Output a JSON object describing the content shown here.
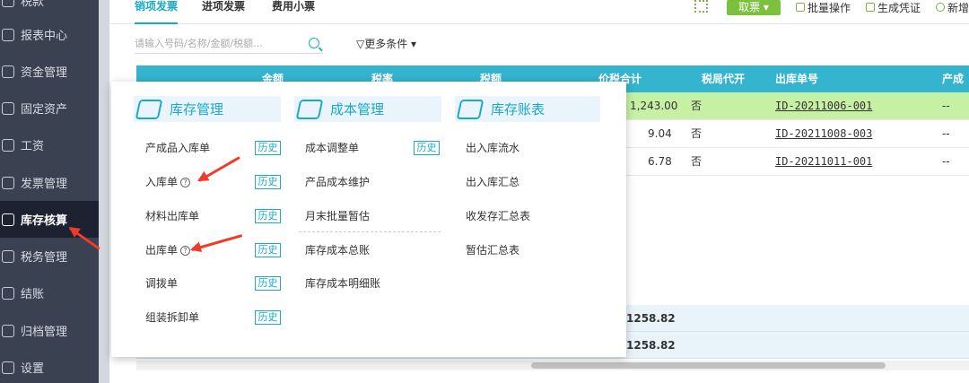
{
  "sidebar": {
    "items": [
      {
        "label": "税款",
        "icon": "home-icon"
      },
      {
        "label": "报表中心",
        "icon": "chart-icon"
      },
      {
        "label": "资金管理",
        "icon": "money-icon"
      },
      {
        "label": "固定资产",
        "icon": "building-icon"
      },
      {
        "label": "工资",
        "icon": "wallet-icon"
      },
      {
        "label": "发票管理",
        "icon": "invoice-icon"
      },
      {
        "label": "库存核算",
        "icon": "warehouse-icon"
      },
      {
        "label": "税务管理",
        "icon": "tax-icon"
      },
      {
        "label": "结账",
        "icon": "lock-icon"
      },
      {
        "label": "归档管理",
        "icon": "archive-icon"
      },
      {
        "label": "设置",
        "icon": "gear-icon"
      }
    ],
    "active_index": 6
  },
  "tabs": [
    "销项发票",
    "进项发票",
    "费用小票"
  ],
  "toolbar": {
    "ticket_label": "取票 ▾",
    "batch_label": "批量操作",
    "voucher_label": "生成凭证",
    "add_label": "新增"
  },
  "search": {
    "placeholder": "请输入号码/名称/金额/税额..."
  },
  "filter_label": "更多条件 ▾",
  "table": {
    "headers": [
      "金额",
      "税率",
      "税额",
      "价税合计",
      "税局代开",
      "出库单号",
      "产成"
    ],
    "rows": [
      {
        "total": "1,243.00",
        "agent": "否",
        "out_no": "ID-20211006-001",
        "prod": "--",
        "selected": true
      },
      {
        "total": "9.04",
        "agent": "否",
        "out_no": "ID-20211008-003",
        "prod": "--",
        "selected": false
      },
      {
        "total": "6.78",
        "agent": "否",
        "out_no": "ID-20211011-001",
        "prod": "--",
        "selected": false
      }
    ],
    "sums": [
      "1258.82",
      "1258.82"
    ]
  },
  "menu": {
    "columns": [
      {
        "title": "库存管理",
        "icon": "inventory-icon",
        "items": [
          {
            "label": "产成品入库单",
            "history": "历史",
            "help": false
          },
          {
            "label": "入库单",
            "history": "历史",
            "help": true
          },
          {
            "label": "材料出库单",
            "history": "历史",
            "help": false
          },
          {
            "label": "出库单",
            "history": "历史",
            "help": true
          },
          {
            "label": "调拨单",
            "history": "历史",
            "help": false
          },
          {
            "label": "组装拆卸单",
            "history": "历史",
            "help": false
          }
        ]
      },
      {
        "title": "成本管理",
        "icon": "cost-icon",
        "items": [
          {
            "label": "成本调整单",
            "history": "历史"
          },
          {
            "label": "产品成本维护"
          },
          {
            "label": "月末批量暂估"
          },
          {
            "label": "库存成本总账"
          },
          {
            "label": "库存成本明细账"
          }
        ]
      },
      {
        "title": "库存账表",
        "icon": "report-icon",
        "items": [
          {
            "label": "出入库流水"
          },
          {
            "label": "出入库汇总"
          },
          {
            "label": "收发存汇总表"
          },
          {
            "label": "暂估汇总表"
          }
        ]
      }
    ]
  },
  "colors": {
    "accent": "#1ba9c7",
    "sidebar": "#3a4150",
    "green": "#7cc13d",
    "arrow": "#f03a2c"
  }
}
